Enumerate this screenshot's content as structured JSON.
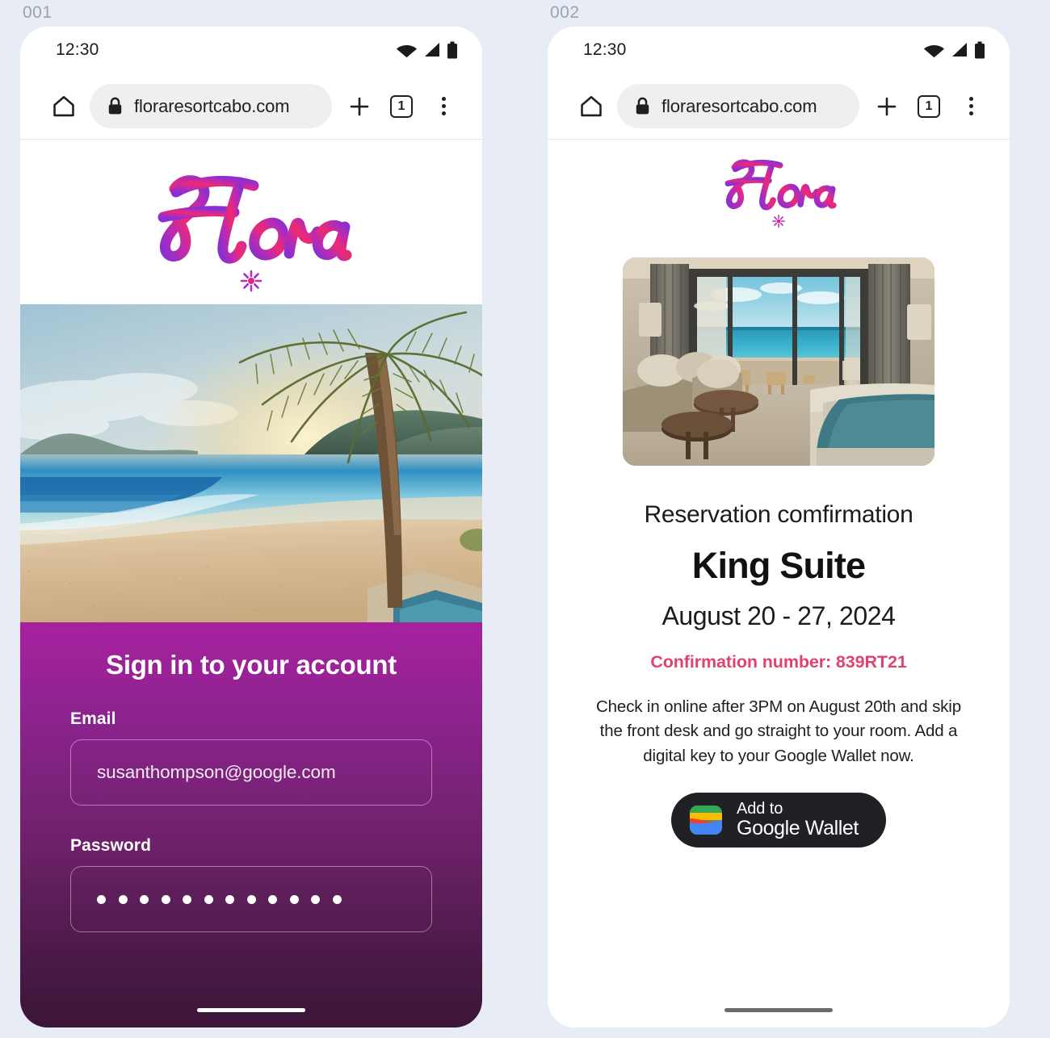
{
  "canvas": {
    "background": "#e8ecf5"
  },
  "frames": [
    {
      "label": "001",
      "statusbar": {
        "time": "12:30",
        "icons": [
          "wifi-icon",
          "signal-icon",
          "battery-icon"
        ]
      },
      "browser": {
        "home_icon": "home-icon",
        "lock_icon": "lock-icon",
        "url": "floraresortcabo.com",
        "new_tab_icon": "plus-icon",
        "tab_count": "1",
        "menu_icon": "overflow-menu-icon"
      },
      "brand": {
        "wordmark": "Flora",
        "burst_icon": "flower-burst-icon"
      },
      "hero": {
        "alt": "sunset-beach-palm-tree-photo"
      },
      "signin": {
        "heading": "Sign in to your account",
        "email_label": "Email",
        "email_value": "susanthompson@google.com",
        "email_placeholder": "Email",
        "password_label": "Password",
        "password_masked": "••••••••••••",
        "password_dot_count": 12,
        "password_placeholder": "Password"
      },
      "home_indicator": "light"
    },
    {
      "label": "002",
      "statusbar": {
        "time": "12:30",
        "icons": [
          "wifi-icon",
          "signal-icon",
          "battery-icon"
        ]
      },
      "browser": {
        "home_icon": "home-icon",
        "lock_icon": "lock-icon",
        "url": "floraresortcabo.com",
        "new_tab_icon": "plus-icon",
        "tab_count": "1",
        "menu_icon": "overflow-menu-icon"
      },
      "brand": {
        "wordmark": "Flora",
        "burst_icon": "flower-burst-icon"
      },
      "room_photo": {
        "alt": "hotel-suite-ocean-view-photo"
      },
      "confirmation": {
        "subtitle": "Reservation comfirmation",
        "room_name": "King Suite",
        "dates": "August 20 - 27, 2024",
        "confirmation_line": "Confirmation number: 839RT21",
        "body": "Check in online after 3PM on August 20th and skip the front desk and go straight to your room. Add a digital key to your Google Wallet now.",
        "wallet_button": {
          "line1": "Add to",
          "line2": "Google Wallet",
          "icon": "google-wallet-icon"
        }
      },
      "home_indicator": "dark"
    }
  ],
  "colors": {
    "brand_pink": "#e0358b",
    "brand_purple": "#9b2fc0",
    "confirmation_pink": "#e0436f",
    "signin_gradient_top": "#a8219f",
    "signin_gradient_bottom": "#3b1538",
    "wallet_button_bg": "#202124",
    "page_background": "#e8ecf5",
    "omnibox_bg": "#eeeff0"
  }
}
